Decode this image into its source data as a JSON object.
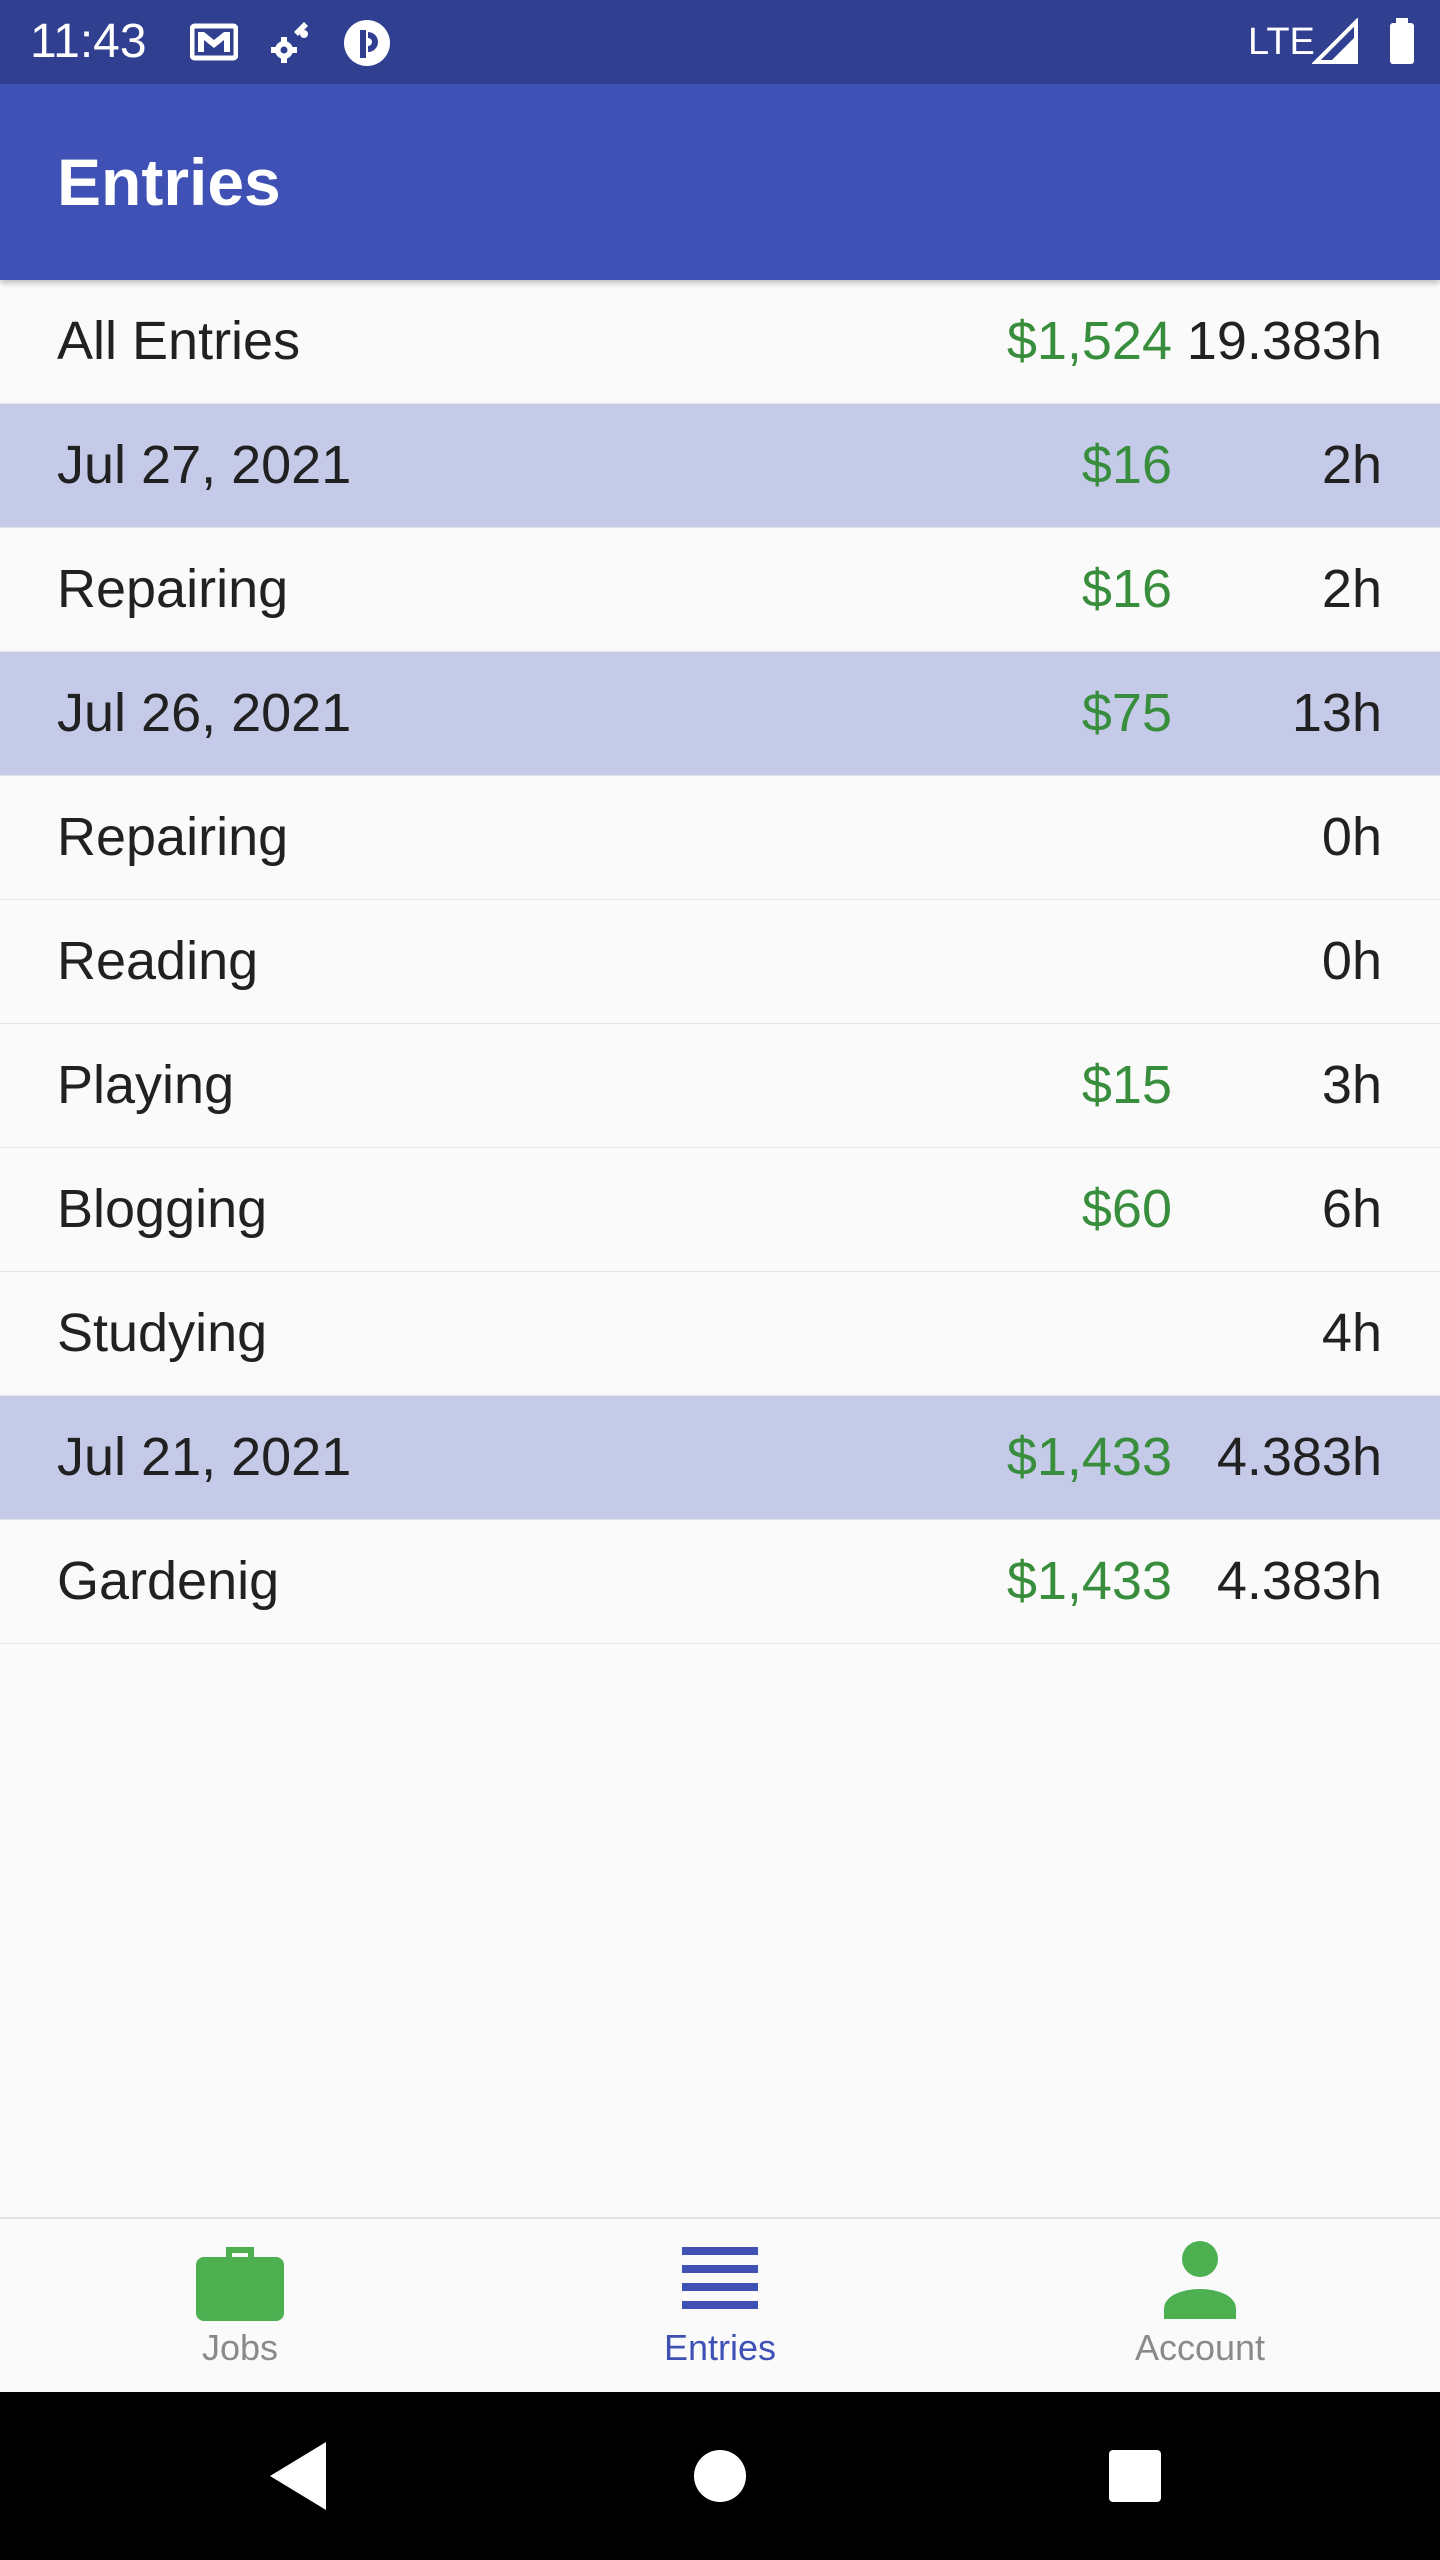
{
  "status_bar": {
    "time": "11:43",
    "network": "LTE",
    "icons": [
      "gmail-icon",
      "settings-sync-icon",
      "app-circle-icon",
      "signal-icon",
      "battery-icon"
    ]
  },
  "app_bar": {
    "title": "Entries"
  },
  "entries": [
    {
      "label": "All Entries",
      "amount": "$1,524",
      "hours": "19.383h",
      "type": "total"
    },
    {
      "label": "Jul 27, 2021",
      "amount": "$16",
      "hours": "2h",
      "type": "date"
    },
    {
      "label": "Repairing",
      "amount": "$16",
      "hours": "2h",
      "type": "job"
    },
    {
      "label": "Jul 26, 2021",
      "amount": "$75",
      "hours": "13h",
      "type": "date"
    },
    {
      "label": "Repairing",
      "amount": "",
      "hours": "0h",
      "type": "job"
    },
    {
      "label": "Reading",
      "amount": "",
      "hours": "0h",
      "type": "job"
    },
    {
      "label": "Playing",
      "amount": "$15",
      "hours": "3h",
      "type": "job"
    },
    {
      "label": "Blogging",
      "amount": "$60",
      "hours": "6h",
      "type": "job"
    },
    {
      "label": "Studying",
      "amount": "",
      "hours": "4h",
      "type": "job"
    },
    {
      "label": "Jul 21, 2021",
      "amount": "$1,433",
      "hours": "4.383h",
      "type": "date"
    },
    {
      "label": "Gardenig",
      "amount": "$1,433",
      "hours": "4.383h",
      "type": "job"
    }
  ],
  "bottom_nav": {
    "items": [
      {
        "label": "Jobs",
        "icon": "briefcase-icon",
        "active": false
      },
      {
        "label": "Entries",
        "icon": "list-icon",
        "active": true
      },
      {
        "label": "Account",
        "icon": "person-icon",
        "active": false
      }
    ]
  },
  "colors": {
    "primary": "#3f51b5",
    "primary_dark": "#303f8f",
    "date_row": "#c5cae9",
    "money": "#388e3c",
    "nav_icon_inactive": "#4caf50"
  }
}
